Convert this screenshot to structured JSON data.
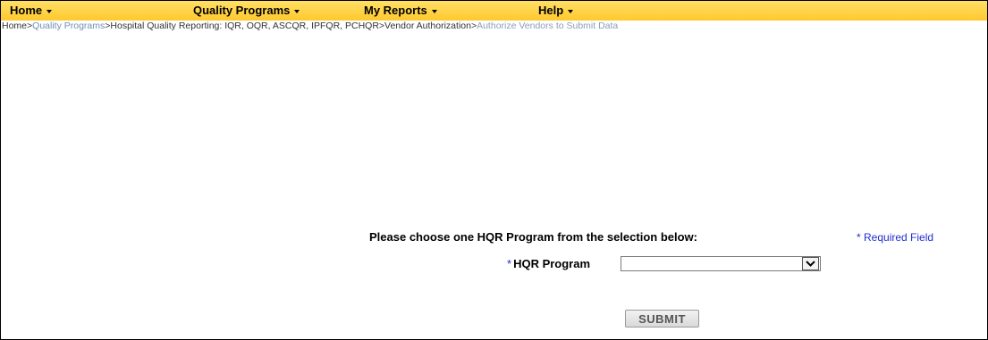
{
  "nav": {
    "items": [
      {
        "label": "Home"
      },
      {
        "label": "Quality Programs"
      },
      {
        "label": "My Reports"
      },
      {
        "label": "Help"
      }
    ]
  },
  "breadcrumb": {
    "home": "Home",
    "quality_programs": "Quality Programs",
    "hospital_quality": "Hospital Quality Reporting: IQR, OQR, ASCQR, IPFQR, PCHQR",
    "vendor_authorization": "Vendor Authorization",
    "current": "Authorize Vendors to Submit Data",
    "separator": ">"
  },
  "form": {
    "prompt": "Please choose one HQR Program from the selection below:",
    "required_note": "* Required Field",
    "asterisk": "*",
    "field_label": "HQR Program",
    "selected_value": "",
    "submit_label": "SUBMIT"
  },
  "colors": {
    "nav_bg": "#ffc82e",
    "link": "#6f8fb5",
    "required": "#1f2fd0"
  }
}
